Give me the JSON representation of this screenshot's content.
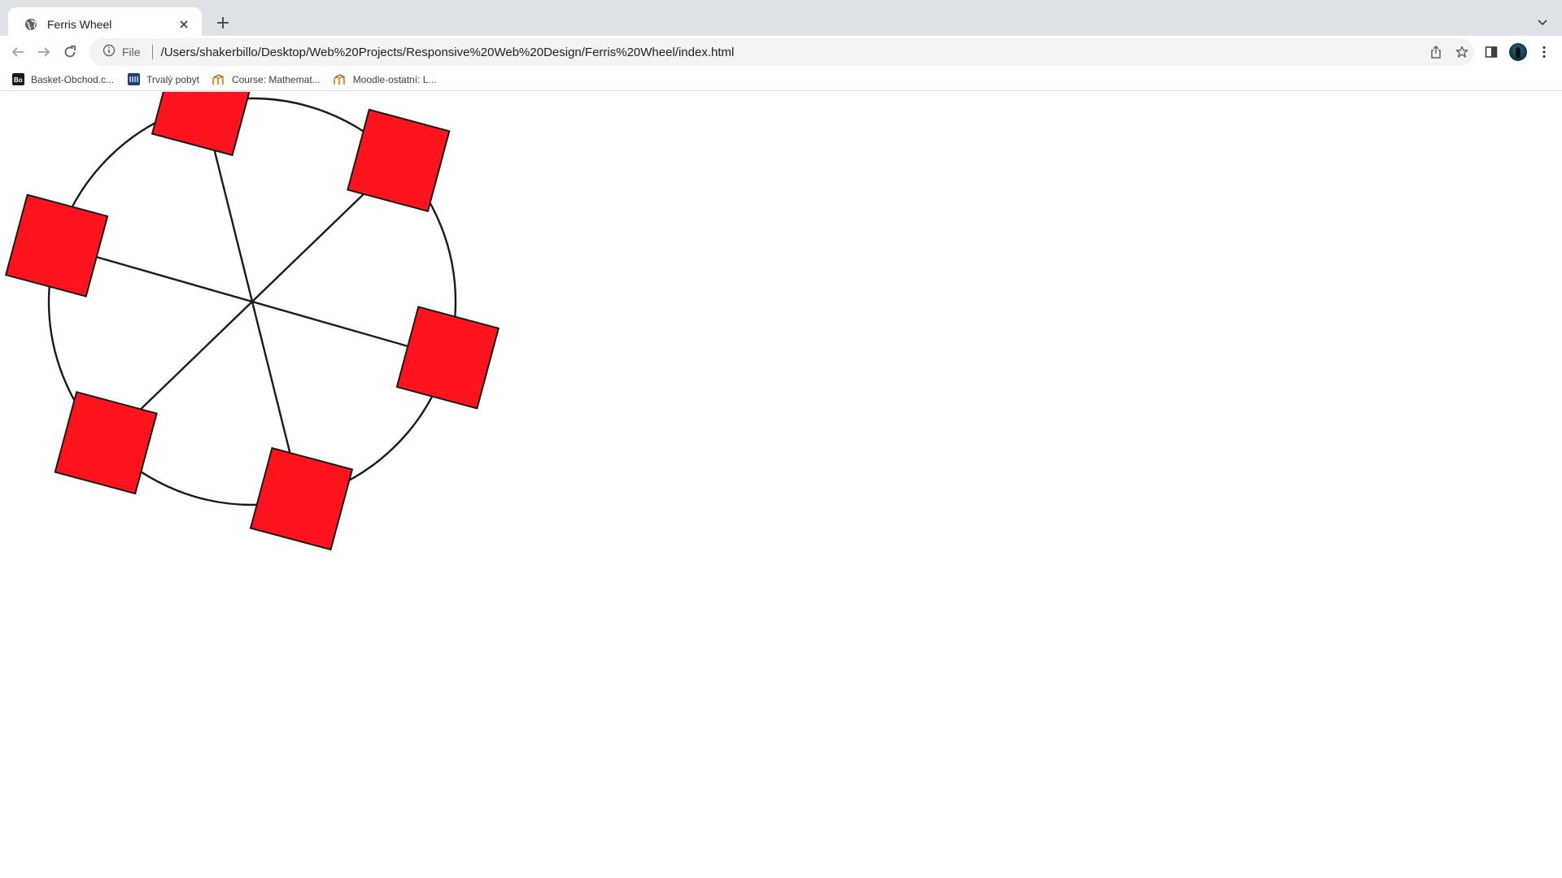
{
  "browser": {
    "tab": {
      "title": "Ferris Wheel",
      "favicon": "globe-icon"
    },
    "toolbar": {
      "site_info_label": "File",
      "url": "/Users/shakerbillo/Desktop/Web%20Projects/Responsive%20Web%20Design/Ferris%20Wheel/index.html"
    },
    "bookmarks": [
      {
        "label": "Basket-Obchod.c...",
        "icon": "bo-logo-icon"
      },
      {
        "label": "Trvalý pobyt",
        "icon": "mvcr-logo-icon"
      },
      {
        "label": "Course: Mathemat...",
        "icon": "moodle-icon"
      },
      {
        "label": "Moodle-ostatní: L...",
        "icon": "moodle-icon"
      }
    ]
  },
  "page": {
    "ferris_wheel": {
      "cabin_count": 6,
      "cabin_color": "#ff141e",
      "frame_color": "#1a1a1a",
      "background": "#ffffff"
    }
  }
}
